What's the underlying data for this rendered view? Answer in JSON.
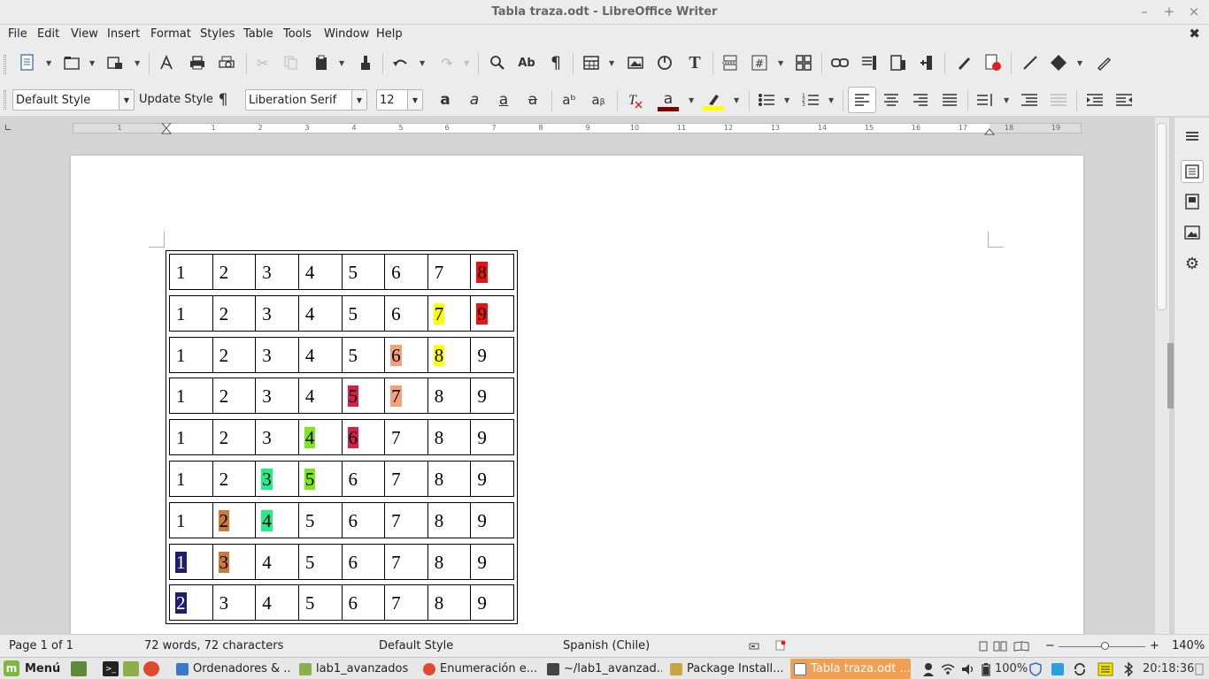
{
  "window": {
    "title": "Tabla traza.odt - LibreOffice Writer",
    "controls": {
      "minimize": "–",
      "maximize": "+",
      "close": "×"
    }
  },
  "menubar": {
    "items": [
      "File",
      "Edit",
      "View",
      "Insert",
      "Format",
      "Styles",
      "Table",
      "Tools",
      "Window",
      "Help"
    ],
    "close_document": "✖"
  },
  "formatting": {
    "paragraph_style": "Default Style",
    "update_style": "Update Style",
    "font_name": "Liberation Serif",
    "font_size": "12",
    "font_color": "#800000",
    "highlight_color": "#ffff00"
  },
  "ruler": {
    "numbers": [
      "1",
      "1",
      "2",
      "3",
      "4",
      "5",
      "6",
      "7",
      "8",
      "9",
      "10",
      "11",
      "12",
      "13",
      "14",
      "15",
      "16",
      "17",
      "18",
      "19"
    ]
  },
  "table": {
    "rows": [
      [
        {
          "v": "1"
        },
        {
          "v": "2"
        },
        {
          "v": "3"
        },
        {
          "v": "4"
        },
        {
          "v": "5"
        },
        {
          "v": "6"
        },
        {
          "v": "7"
        },
        {
          "v": "8",
          "bg": "#ee1111"
        }
      ],
      [
        {
          "v": "1"
        },
        {
          "v": "2"
        },
        {
          "v": "3"
        },
        {
          "v": "4"
        },
        {
          "v": "5"
        },
        {
          "v": "6"
        },
        {
          "v": "7",
          "bg": "#ffff00"
        },
        {
          "v": "9",
          "bg": "#ee1111"
        }
      ],
      [
        {
          "v": "1"
        },
        {
          "v": "2"
        },
        {
          "v": "3"
        },
        {
          "v": "4"
        },
        {
          "v": "5"
        },
        {
          "v": "6",
          "bg": "#f4a07a"
        },
        {
          "v": "8",
          "bg": "#ffff00"
        },
        {
          "v": "9"
        }
      ],
      [
        {
          "v": "1"
        },
        {
          "v": "2"
        },
        {
          "v": "3"
        },
        {
          "v": "4"
        },
        {
          "v": "5",
          "bg": "#d6204a"
        },
        {
          "v": "7",
          "bg": "#f4a07a"
        },
        {
          "v": "8"
        },
        {
          "v": "9"
        }
      ],
      [
        {
          "v": "1"
        },
        {
          "v": "2"
        },
        {
          "v": "3"
        },
        {
          "v": "4",
          "bg": "#7fe61e"
        },
        {
          "v": "6",
          "bg": "#d6204a"
        },
        {
          "v": "7"
        },
        {
          "v": "8"
        },
        {
          "v": "9"
        }
      ],
      [
        {
          "v": "1"
        },
        {
          "v": "2"
        },
        {
          "v": "3",
          "bg": "#22ee88"
        },
        {
          "v": "5",
          "bg": "#7fe61e"
        },
        {
          "v": "6"
        },
        {
          "v": "7"
        },
        {
          "v": "8"
        },
        {
          "v": "9"
        }
      ],
      [
        {
          "v": "1"
        },
        {
          "v": "2",
          "bg": "#cc7a3a"
        },
        {
          "v": "4",
          "bg": "#22ee88"
        },
        {
          "v": "5"
        },
        {
          "v": "6"
        },
        {
          "v": "7"
        },
        {
          "v": "8"
        },
        {
          "v": "9"
        }
      ],
      [
        {
          "v": "1",
          "bg": "#1e1e6e",
          "fg": "#ffffff"
        },
        {
          "v": "3",
          "bg": "#cc7a3a"
        },
        {
          "v": "4"
        },
        {
          "v": "5"
        },
        {
          "v": "6"
        },
        {
          "v": "7"
        },
        {
          "v": "8"
        },
        {
          "v": "9"
        }
      ],
      [
        {
          "v": "2",
          "bg": "#1e1e6e",
          "fg": "#ffffff"
        },
        {
          "v": "3"
        },
        {
          "v": "4"
        },
        {
          "v": "5"
        },
        {
          "v": "6"
        },
        {
          "v": "7"
        },
        {
          "v": "8"
        },
        {
          "v": "9"
        }
      ]
    ]
  },
  "statusbar": {
    "page": "Page 1 of 1",
    "word_count": "72 words, 72 characters",
    "page_style": "Default Style",
    "language": "Spanish (Chile)",
    "zoom_minus": "−",
    "zoom_plus": "+",
    "zoom": "140%",
    "zoom_level_percent": 140
  },
  "taskbar": {
    "menu_label": "Menú",
    "tasks": [
      {
        "label": "Ordenadores & ...",
        "icon_color": "#3a78c8"
      },
      {
        "label": "lab1_avanzados",
        "icon_color": "#8bb04a"
      },
      {
        "label": "Enumeración e...",
        "icon_color": "#e04a2a"
      },
      {
        "label": "~/lab1_avanzad...",
        "icon_color": "#444444"
      },
      {
        "label": "Package Install...",
        "icon_color": "#c9a442"
      },
      {
        "label": "Tabla traza.odt ...",
        "icon_color": "#3a78c8"
      }
    ],
    "battery": "100%",
    "clock": "20:18:36"
  }
}
